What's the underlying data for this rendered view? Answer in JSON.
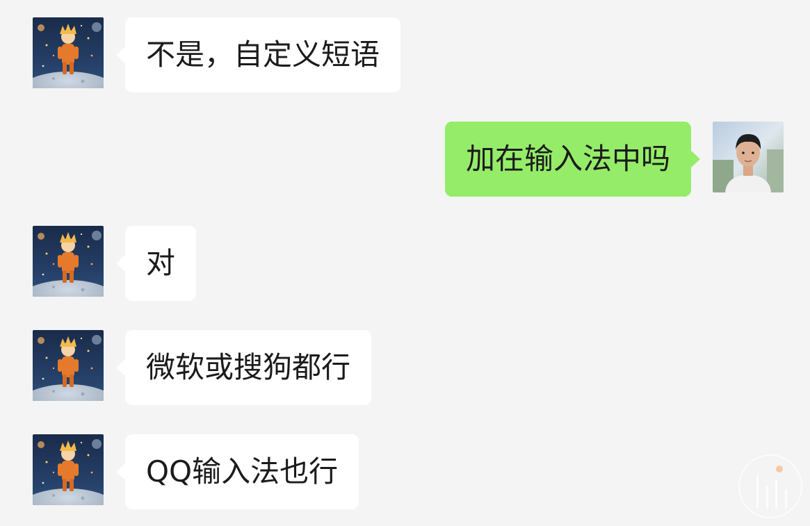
{
  "messages": [
    {
      "side": "left",
      "sender": "contact",
      "text": "不是，自定义短语"
    },
    {
      "side": "right",
      "sender": "me",
      "text": "加在输入法中吗"
    },
    {
      "side": "left",
      "sender": "contact",
      "text": "对"
    },
    {
      "side": "left",
      "sender": "contact",
      "text": "微软或搜狗都行"
    },
    {
      "side": "left",
      "sender": "contact",
      "text": "QQ输入法也行"
    }
  ],
  "colors": {
    "background": "#f4f4f4",
    "incoming_bubble": "#ffffff",
    "outgoing_bubble": "#95ec69",
    "text": "#1b1b1b"
  },
  "icons": {
    "contact_avatar": "little-prince-avatar",
    "my_avatar": "user-photo-avatar",
    "watermark": "watermark-logo"
  }
}
